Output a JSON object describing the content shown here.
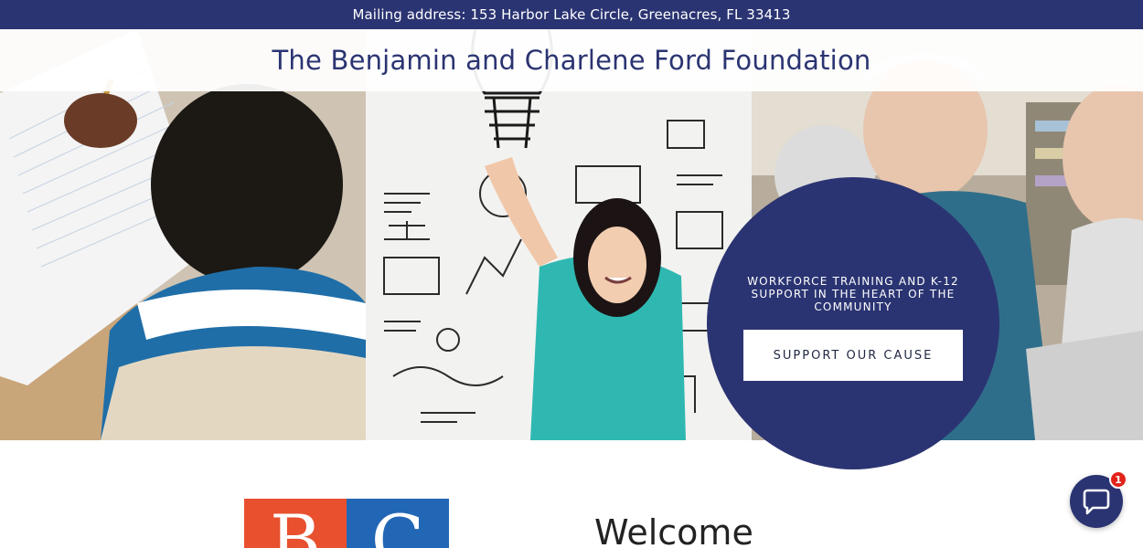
{
  "topbar": {
    "mailing_address": "Mailing address: 153 Harbor Lake Circle, Greenacres, FL 33413"
  },
  "header": {
    "site_title": "The Benjamin and Charlene Ford Foundation"
  },
  "hero": {
    "images": [
      {
        "name": "student-writing-photo",
        "description": "Student writing in a notebook"
      },
      {
        "name": "woman-whiteboard-photo",
        "description": "Woman in front of a whiteboard with sketches"
      },
      {
        "name": "seniors-class-photo",
        "description": "Seniors in a class"
      }
    ],
    "cta": {
      "tagline": "WORKFORCE TRAINING AND K-12 SUPPORT IN THE HEART OF THE COMMUNITY",
      "button_label": "SUPPORT OUR CAUSE"
    }
  },
  "logo": {
    "left_letter": "B",
    "right_letter": "C"
  },
  "welcome": {
    "heading": "Welcome"
  },
  "chat": {
    "badge_count": "1",
    "icon": "chat-bubble-icon"
  },
  "colors": {
    "brand_navy": "#2b3472",
    "logo_orange": "#e8502e",
    "logo_blue": "#2267b5",
    "badge_red": "#e2231a"
  }
}
